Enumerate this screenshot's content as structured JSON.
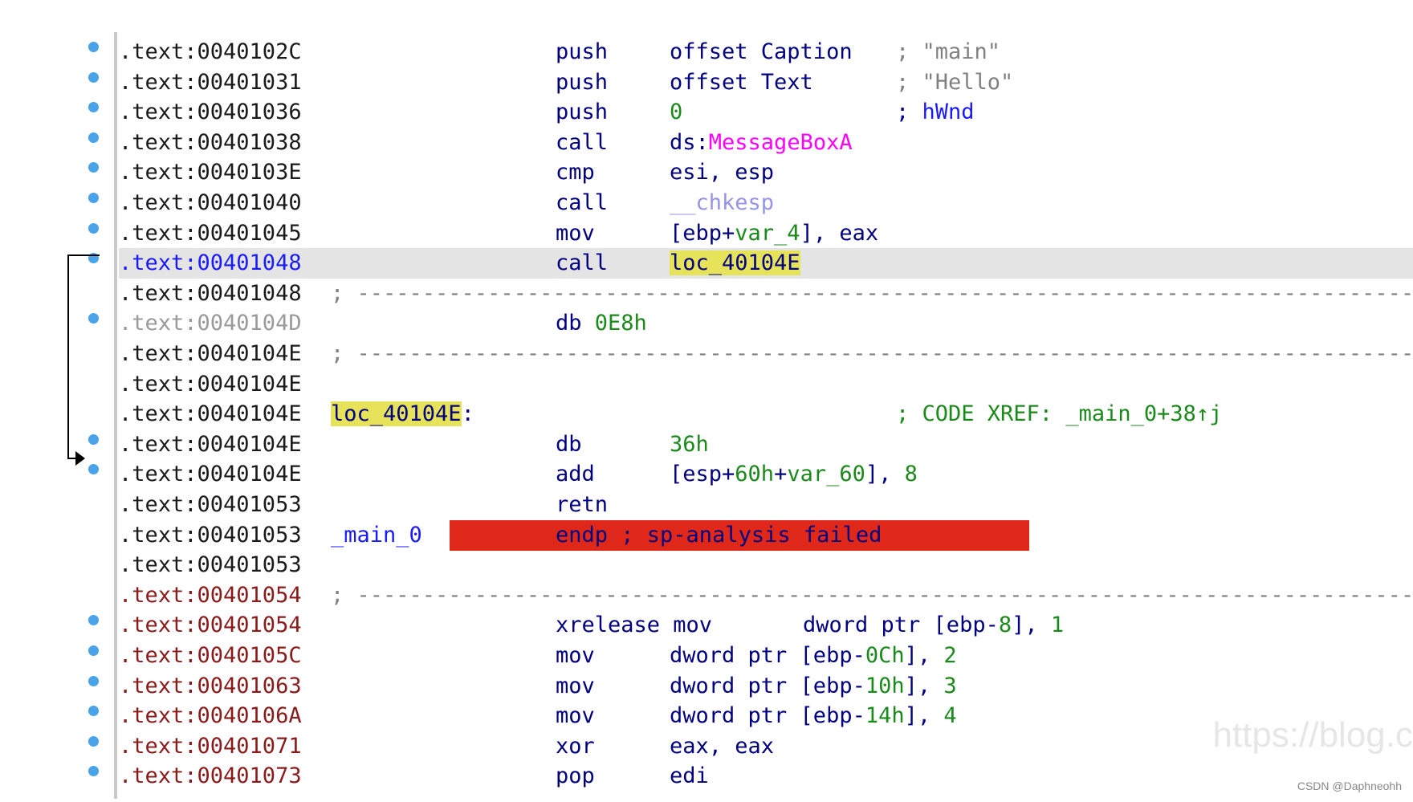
{
  "rows": [
    {
      "addr": ".text:0040102C",
      "addr_color": "black",
      "mn": "push",
      "op": [
        {
          "t": "offset Caption",
          "c": "navy"
        }
      ],
      "cmt": [
        {
          "t": "; ",
          "c": "comment"
        },
        {
          "t": "\"main\"",
          "c": "comment"
        }
      ]
    },
    {
      "addr": ".text:00401031",
      "addr_color": "black",
      "mn": "push",
      "op": [
        {
          "t": "offset Text",
          "c": "navy"
        }
      ],
      "cmt": [
        {
          "t": "; ",
          "c": "comment"
        },
        {
          "t": "\"Hello\"",
          "c": "comment"
        }
      ]
    },
    {
      "addr": ".text:00401036",
      "addr_color": "black",
      "mn": "push",
      "op": [
        {
          "t": "0",
          "c": "green"
        }
      ],
      "cmt": [
        {
          "t": "; ",
          "c": "navy"
        },
        {
          "t": "hWnd",
          "c": "blue"
        }
      ]
    },
    {
      "addr": ".text:00401038",
      "addr_color": "black",
      "mn": "call",
      "op": [
        {
          "t": "ds:",
          "c": "navy"
        },
        {
          "t": "MessageBoxA",
          "c": "magenta"
        }
      ],
      "cmt": []
    },
    {
      "addr": ".text:0040103E",
      "addr_color": "black",
      "mn": "cmp",
      "op": [
        {
          "t": "esi, esp",
          "c": "navy"
        }
      ],
      "cmt": []
    },
    {
      "addr": ".text:00401040",
      "addr_color": "black",
      "mn": "call",
      "op": [
        {
          "t": "__chkesp",
          "c": "lav"
        }
      ],
      "cmt": []
    },
    {
      "addr": ".text:00401045",
      "addr_color": "black",
      "mn": "mov",
      "op": [
        {
          "t": "[ebp+",
          "c": "navy"
        },
        {
          "t": "var_4",
          "c": "green"
        },
        {
          "t": "], eax",
          "c": "navy"
        }
      ],
      "cmt": []
    },
    {
      "addr": ".text:00401048",
      "addr_color": "blue",
      "mn": "call",
      "op": [
        {
          "t": "loc_40104E",
          "c": "navy",
          "hl": true
        }
      ],
      "cmt": [],
      "highlight": true
    },
    {
      "addr": ".text:00401048",
      "addr_color": "black",
      "sep": true
    },
    {
      "addr": ".text:0040104D",
      "addr_color": "gray",
      "mn": "db 0E8h",
      "mn_partial": true,
      "op": [],
      "cmt": []
    },
    {
      "addr": ".text:0040104E",
      "addr_color": "black",
      "sep": true
    },
    {
      "addr": ".text:0040104E",
      "addr_color": "black",
      "mn": "",
      "op": [],
      "cmt": []
    },
    {
      "addr": ".text:0040104E",
      "addr_color": "black",
      "label": "loc_40104E",
      "label_hl": true,
      "label_suffix": ":",
      "mn": "",
      "op": [],
      "cmt": [
        {
          "t": "; CODE XREF: _main_0+38↑j",
          "c": "green"
        }
      ]
    },
    {
      "addr": ".text:0040104E",
      "addr_color": "black",
      "mn": "db",
      "op": [
        {
          "t": "36h",
          "c": "green"
        }
      ],
      "cmt": []
    },
    {
      "addr": ".text:0040104E",
      "addr_color": "black",
      "mn": "add",
      "op": [
        {
          "t": "[esp+",
          "c": "navy"
        },
        {
          "t": "60h",
          "c": "green"
        },
        {
          "t": "+",
          "c": "navy"
        },
        {
          "t": "var_60",
          "c": "green"
        },
        {
          "t": "], ",
          "c": "navy"
        },
        {
          "t": "8",
          "c": "green"
        }
      ],
      "cmt": []
    },
    {
      "addr": ".text:00401053",
      "addr_color": "black",
      "mn": "retn",
      "op": [],
      "cmt": []
    },
    {
      "addr": ".text:00401053",
      "addr_color": "black",
      "endp": true,
      "label": "_main_0",
      "mn": "endp ; sp-analysis failed",
      "op": [],
      "cmt": []
    },
    {
      "addr": ".text:00401053",
      "addr_color": "black",
      "mn": "",
      "op": [],
      "cmt": []
    },
    {
      "addr": ".text:00401054",
      "addr_color": "brown",
      "sep": true
    },
    {
      "addr": ".text:00401054",
      "addr_color": "brown",
      "mn": "xrelease mov",
      "op": [],
      "op_wide": [
        {
          "t": "dword ptr [ebp-",
          "c": "navy"
        },
        {
          "t": "8",
          "c": "green"
        },
        {
          "t": "], ",
          "c": "navy"
        },
        {
          "t": "1",
          "c": "green"
        }
      ],
      "cmt": []
    },
    {
      "addr": ".text:0040105C",
      "addr_color": "brown",
      "mn": "mov",
      "op": [
        {
          "t": "dword ptr [ebp-",
          "c": "navy"
        },
        {
          "t": "0Ch",
          "c": "green"
        },
        {
          "t": "], ",
          "c": "navy"
        },
        {
          "t": "2",
          "c": "green"
        }
      ],
      "cmt": []
    },
    {
      "addr": ".text:00401063",
      "addr_color": "brown",
      "mn": "mov",
      "op": [
        {
          "t": "dword ptr [ebp-",
          "c": "navy"
        },
        {
          "t": "10h",
          "c": "green"
        },
        {
          "t": "], ",
          "c": "navy"
        },
        {
          "t": "3",
          "c": "green"
        }
      ],
      "cmt": []
    },
    {
      "addr": ".text:0040106A",
      "addr_color": "brown",
      "mn": "mov",
      "op": [
        {
          "t": "dword ptr [ebp-",
          "c": "navy"
        },
        {
          "t": "14h",
          "c": "green"
        },
        {
          "t": "], ",
          "c": "navy"
        },
        {
          "t": "4",
          "c": "green"
        }
      ],
      "cmt": []
    },
    {
      "addr": ".text:00401071",
      "addr_color": "brown",
      "mn": "xor",
      "op": [
        {
          "t": "eax, eax",
          "c": "navy"
        }
      ],
      "cmt": []
    },
    {
      "addr": ".text:00401073",
      "addr_color": "brown",
      "mn": "pop",
      "op": [
        {
          "t": "edi",
          "c": "navy"
        }
      ],
      "cmt": []
    }
  ],
  "separator": "; --------------------------------------------------------------------------------------------------------------",
  "dot_rows": [
    0,
    1,
    2,
    3,
    4,
    5,
    6,
    7,
    9,
    13,
    14,
    19,
    20,
    21,
    22,
    23,
    24
  ],
  "watermark": "https://blog.c",
  "credit": "CSDN @Daphneohh",
  "colors": {
    "navy": "#000080",
    "green": "#1a8a1a",
    "blue": "#1a1aff",
    "magenta": "#ff00ff",
    "gray": "#9a9a9a",
    "brown": "#8b1a1a",
    "highlight_yellow": "#e6e35a",
    "error_red": "#e0281a"
  }
}
